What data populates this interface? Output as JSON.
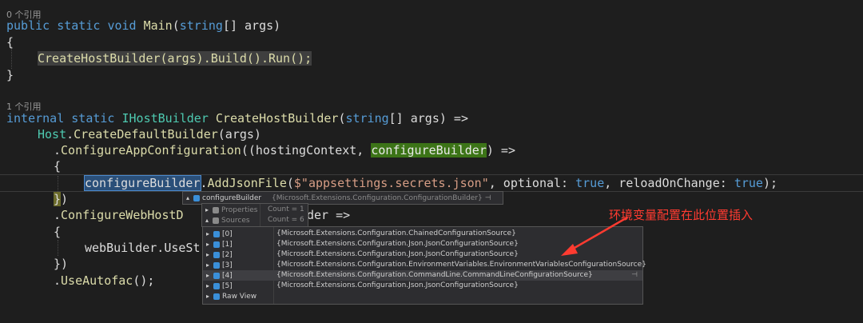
{
  "codelens": [
    "0 个引用",
    "1 个引用"
  ],
  "code": {
    "main_kw1": "public",
    "main_kw2": "static",
    "main_kw3": "void",
    "main_name": "Main",
    "main_params_pre": "(",
    "main_string": "string",
    "main_params_post": "[] args)",
    "open_brace": "{",
    "run_stmt": "CreateHostBuilder(args).Build().Run();",
    "close_brace": "}",
    "chb_kw1": "internal",
    "chb_kw2": "static",
    "chb_type": "IHostBuilder",
    "chb_name": "CreateHostBuilder",
    "chb_string": "string",
    "chb_args": "[] args) =>",
    "host_type": "Host",
    "host_call": ".",
    "host_method": "CreateDefaultBuilder",
    "host_args": "(args)",
    "cac_dot": ".",
    "cac_method": "ConfigureAppConfiguration",
    "cac_open": "((hostingContext, ",
    "cac_param": "configureBuilder",
    "cac_close": ") =>",
    "lambda_open": "{",
    "add_target": "configureBuilder",
    "add_dot": ".",
    "add_method": "AddJsonFile",
    "add_open": "(",
    "add_str": "$\"appsettings.secrets.json\"",
    "add_opt": ", optional: ",
    "add_true1": "true",
    "add_reload": ", reloadOnChange: ",
    "add_true2": "true",
    "add_end": ");",
    "lambda_close_brace": "}",
    "lambda_close_paren": ")",
    "cwh_dot": ".",
    "cwh_method": "ConfigureWebHostD",
    "cwh_tail": "der =>",
    "web_open": "{",
    "web_stmt": "webBuilder.UseSt",
    "web_close": "})",
    "autofac_dot": ".",
    "autofac_method": "UseAutofac",
    "autofac_end": "();"
  },
  "datatip": {
    "var_name": "configureBuilder",
    "var_type": "{Microsoft.Extensions.Configuration.ConfigurationBuilder}",
    "properties_label": "Properties",
    "properties_count": "Count = 1",
    "sources_label": "Sources",
    "sources_count": "Count = 6",
    "items": [
      {
        "index": "[0]",
        "value": "{Microsoft.Extensions.Configuration.ChainedConfigurationSource}"
      },
      {
        "index": "[1]",
        "value": "{Microsoft.Extensions.Configuration.Json.JsonConfigurationSource}"
      },
      {
        "index": "[2]",
        "value": "{Microsoft.Extensions.Configuration.Json.JsonConfigurationSource}"
      },
      {
        "index": "[3]",
        "value": "{Microsoft.Extensions.Configuration.EnvironmentVariables.EnvironmentVariablesConfigurationSource}"
      },
      {
        "index": "[4]",
        "value": "{Microsoft.Extensions.Configuration.CommandLine.CommandLineConfigurationSource}"
      },
      {
        "index": "[5]",
        "value": "{Microsoft.Extensions.Configuration.Json.JsonConfigurationSource}"
      }
    ],
    "raw_view": "Raw View"
  },
  "annotation": "环境变量配置在此位置插入",
  "colors": {
    "background": "#1e1e1e",
    "keyword": "#569cd6",
    "method": "#dcdcaa",
    "type": "#4ec9b0",
    "string": "#d69d85",
    "annotation": "#ff3b30"
  }
}
